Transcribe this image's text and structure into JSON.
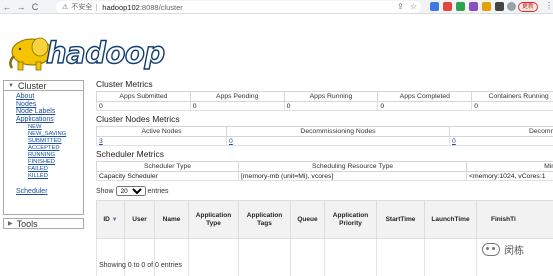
{
  "browser": {
    "back": "←",
    "forward": "→",
    "reload": "C",
    "warning_glyph": "⚠",
    "insecure_label": "不安全",
    "url_host": "hadoop102",
    "url_path": ":8088/cluster",
    "update_label": "更新",
    "menu_glyph": "⋮",
    "share_glyph": "⇪",
    "star_glyph": "☆"
  },
  "logo": {
    "text": "hadoop"
  },
  "sidebar": {
    "cluster_label": "Cluster",
    "items": [
      "About",
      "Nodes",
      "Node Labels",
      "Applications"
    ],
    "app_states": [
      "NEW",
      "NEW_SAVING",
      "SUBMITTED",
      "ACCEPTED",
      "RUNNING",
      "FINISHED",
      "FAILED",
      "KILLED"
    ],
    "scheduler_label": "Scheduler",
    "tools_label": "Tools"
  },
  "cluster_metrics": {
    "title": "Cluster Metrics",
    "headers": [
      "Apps Submitted",
      "Apps Pending",
      "Apps Running",
      "Apps Completed",
      "Containers Running"
    ],
    "values": [
      "0",
      "0",
      "0",
      "0",
      "0"
    ]
  },
  "nodes_metrics": {
    "title": "Cluster Nodes Metrics",
    "headers": [
      "Active Nodes",
      "Decommissioning Nodes",
      "Decommissi"
    ],
    "values": [
      "3",
      "0",
      "0"
    ]
  },
  "scheduler_metrics": {
    "title": "Scheduler Metrics",
    "headers": [
      "Scheduler Type",
      "Scheduling Resource Type",
      "Minimu"
    ],
    "values": [
      "Capacity Scheduler",
      "[memory-mb (unit=Mi), vcores]",
      "<memory:1024, vCores:1"
    ]
  },
  "table_controls": {
    "show_label": "Show",
    "entries_value": "20",
    "entries_label": "entries"
  },
  "apps_table": {
    "headers": [
      "ID",
      "User",
      "Name",
      "Application Type",
      "Application Tags",
      "Queue",
      "Application Priority",
      "StartTime",
      "LaunchTime",
      "FinishTi"
    ],
    "sort_glyph": "▼",
    "footer": "Showing 0 to 0 of 0 entries"
  },
  "watermark": {
    "text": "闵栋"
  },
  "colors": {
    "link": "#1a4fa0",
    "logo_outline": "#103c72",
    "logo_elephant": "#f5c400"
  }
}
